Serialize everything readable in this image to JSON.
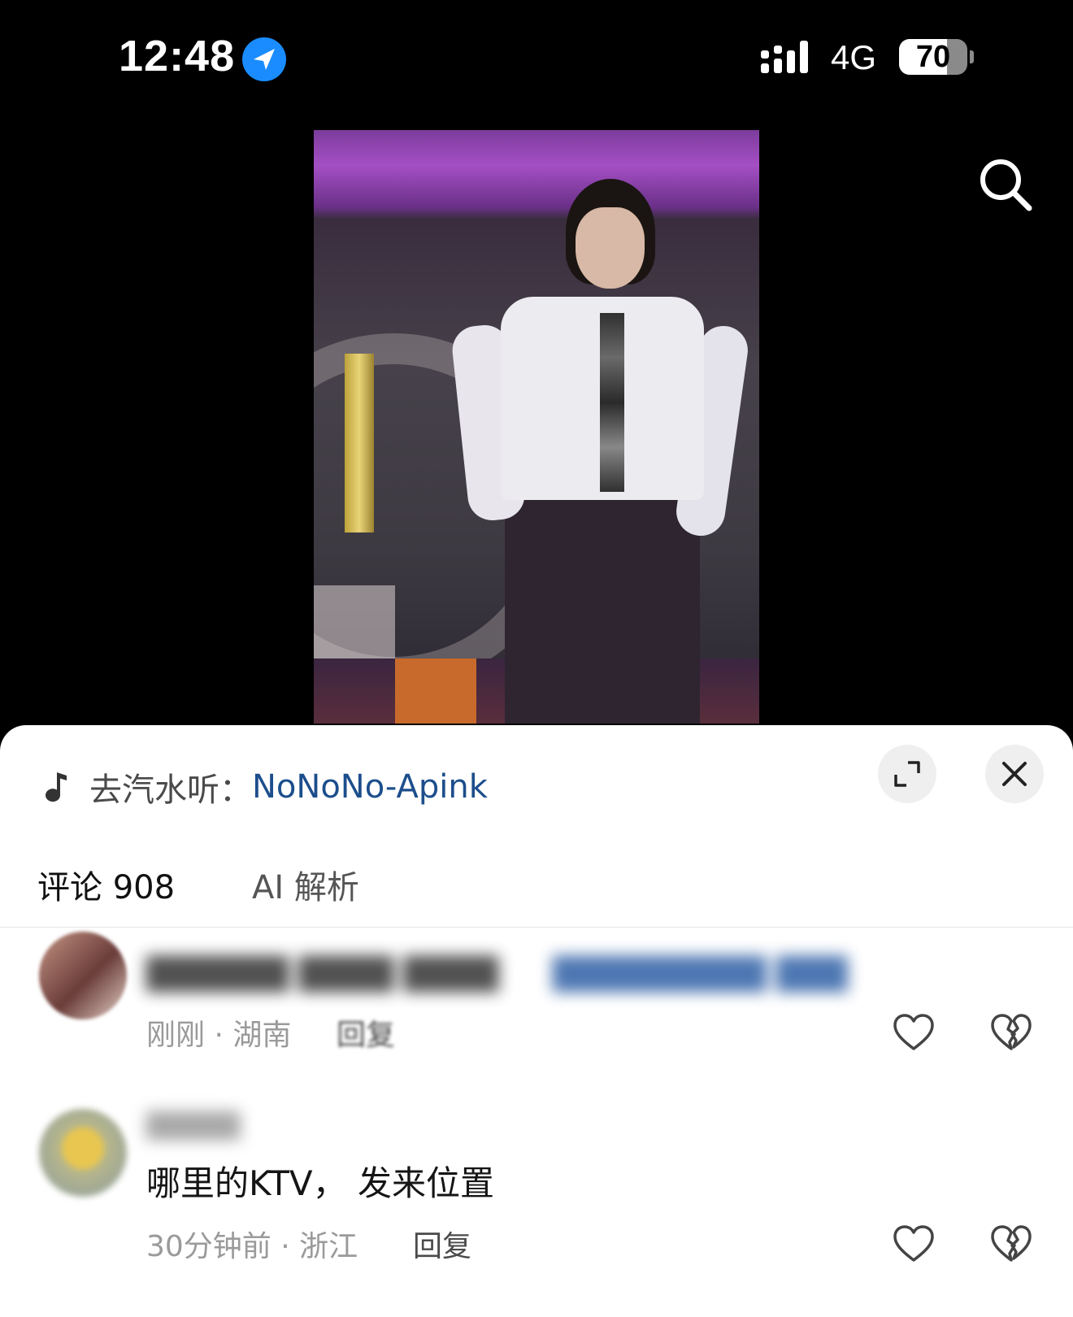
{
  "status_bar": {
    "time": "12:48",
    "network": "4G",
    "battery_level": "70",
    "battery_fraction": 0.7,
    "icons": [
      "location-arrow-icon",
      "signal-icon",
      "battery-icon"
    ]
  },
  "video": {
    "icons": [
      "search-icon"
    ]
  },
  "sheet": {
    "music": {
      "prefix": "去汽水听：",
      "song": "NoNoNo-Apink",
      "icon": "music-note-icon"
    },
    "buttons": {
      "expand_icon": "expand-icon",
      "close_icon": "close-icon"
    },
    "tabs": [
      {
        "label": "评论 908"
      },
      {
        "label": "AI 解析"
      }
    ],
    "comments": [
      {
        "meta": "刚刚 · 湖南",
        "reply": "回复"
      },
      {
        "text": "哪里的KTV， 发来位置",
        "meta": "30分钟前 · 浙江",
        "reply": "回复"
      }
    ]
  },
  "colors": {
    "background": "#000000",
    "sheet": "#ffffff",
    "link": "#1c4e8c",
    "location_badge": "#1a8cff"
  }
}
